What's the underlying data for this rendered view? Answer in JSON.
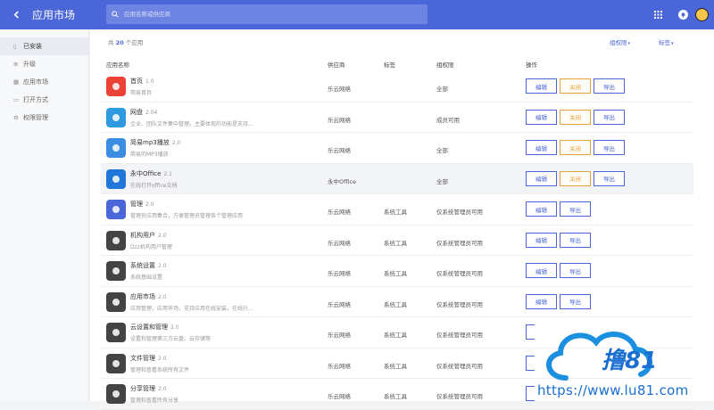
{
  "header": {
    "title": "应用市场",
    "search_placeholder": "应用名称或供应商"
  },
  "sidebar": {
    "items": [
      {
        "label": "已安装",
        "icon": "document-icon",
        "active": true
      },
      {
        "label": "升级",
        "icon": "upgrade-icon",
        "active": false
      },
      {
        "label": "应用市场",
        "icon": "grid-icon",
        "active": false
      },
      {
        "label": "打开方式",
        "icon": "open-with-icon",
        "active": false
      },
      {
        "label": "权限管理",
        "icon": "gear-icon",
        "active": false
      }
    ]
  },
  "summary": {
    "prefix": "共",
    "count": "20",
    "suffix": "个应用"
  },
  "filters": {
    "group_perm": "组权限",
    "tag": "标签"
  },
  "table": {
    "columns": {
      "name": "应用名称",
      "vendor": "供应商",
      "tag": "标签",
      "perm": "组权限",
      "ops": "操作"
    },
    "rows": [
      {
        "name": "首页",
        "version": "1.0",
        "desc": "简易首页",
        "vendor": "乐云网络",
        "tag": "",
        "perm": "全部",
        "icon_color": "#ea4335",
        "buttons": [
          "编辑",
          "关闭",
          "导出"
        ]
      },
      {
        "name": "网盘",
        "version": "2.04",
        "desc": "企业、团队文件集中管理。主要体现的功能是支持...",
        "vendor": "乐云网络",
        "tag": "",
        "perm": "成员可用",
        "icon_color": "#2f9ae0",
        "buttons": [
          "编辑",
          "关闭",
          "导出"
        ]
      },
      {
        "name": "简易mp3播放",
        "version": "2.0",
        "desc": "简易的MP3播放",
        "vendor": "乐云网络",
        "tag": "",
        "perm": "全部",
        "icon_color": "#3a8de0",
        "buttons": [
          "编辑",
          "关闭",
          "导出"
        ]
      },
      {
        "name": "永中Office",
        "version": "2.1",
        "desc": "在线打开office文档",
        "vendor": "永中Office",
        "tag": "",
        "perm": "全部",
        "icon_color": "#1f78d8",
        "buttons": [
          "编辑",
          "关闭",
          "导出"
        ],
        "highlight": true
      },
      {
        "name": "管理",
        "version": "2.0",
        "desc": "管理员应用集合，方便管理员管理各个管理应用",
        "vendor": "乐云网络",
        "tag": "系统工具",
        "perm": "仅系统管理员可用",
        "icon_color": "#4a66d8",
        "buttons": [
          "编辑",
          "导出"
        ]
      },
      {
        "name": "机构用户",
        "version": "2.0",
        "desc": "Dzz机构用户管理",
        "vendor": "乐云网络",
        "tag": "系统工具",
        "perm": "仅系统管理员可用",
        "icon_color": "#444444",
        "buttons": [
          "编辑",
          "导出"
        ]
      },
      {
        "name": "系统设置",
        "version": "2.0",
        "desc": "系统基础设置",
        "vendor": "乐云网络",
        "tag": "系统工具",
        "perm": "仅系统管理员可用",
        "icon_color": "#444444",
        "buttons": [
          "编辑",
          "导出"
        ]
      },
      {
        "name": "应用市场",
        "version": "2.0",
        "desc": "应用管理，应用市场，支持应用在线安装，在线升...",
        "vendor": "乐云网络",
        "tag": "系统工具",
        "perm": "仅系统管理员可用",
        "icon_color": "#444444",
        "buttons": [
          "编辑",
          "导出"
        ]
      },
      {
        "name": "云设置和管理",
        "version": "2.0",
        "desc": "设置和管理第三方云盘、云存储等",
        "vendor": "乐云网络",
        "tag": "系统工具",
        "perm": "仅系统管理员可用",
        "icon_color": "#444444",
        "buttons": []
      },
      {
        "name": "文件管理",
        "version": "2.0",
        "desc": "管理和查看系统所有文件",
        "vendor": "乐云网络",
        "tag": "系统工具",
        "perm": "仅系统管理员可用",
        "icon_color": "#444444",
        "buttons": []
      },
      {
        "name": "分享管理",
        "version": "2.0",
        "desc": "管理和查看所有分享",
        "vendor": "乐云网络",
        "tag": "系统工具",
        "perm": "仅系统管理员可用",
        "icon_color": "#444444",
        "buttons": []
      }
    ]
  },
  "watermark": {
    "text": "撸81",
    "url": "https://www.lu81.com"
  },
  "colors": {
    "primary": "#4a66d8",
    "warning": "#e7a23b"
  }
}
